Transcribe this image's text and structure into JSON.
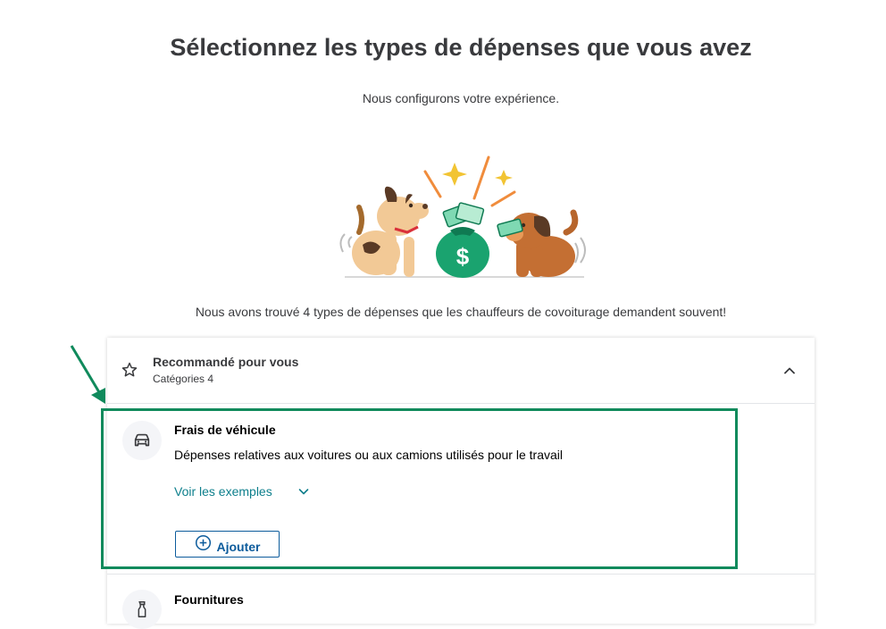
{
  "page": {
    "title": "Sélectionnez les types de dépenses que vous avez",
    "subtitle": "Nous configurons votre expérience.",
    "found_text": "Nous avons trouvé 4 types de dépenses que les chauffeurs de covoiturage demandent souvent!"
  },
  "recommended": {
    "title": "Recommandé pour vous",
    "count": "Catégories 4",
    "items": [
      {
        "title": "Frais de véhicule",
        "description": "Dépenses relatives aux voitures ou aux camions utilisés pour le travail",
        "examples_label": "Voir les exemples",
        "add_label": "Ajouter",
        "icon": "car-icon"
      },
      {
        "title": "Fournitures",
        "icon": "spray-bottle-icon"
      }
    ]
  },
  "colors": {
    "accent_teal": "#0d7f8c",
    "button_blue": "#0d5c9c",
    "highlight_green": "#108a5c",
    "money_green": "#1aa36f"
  }
}
